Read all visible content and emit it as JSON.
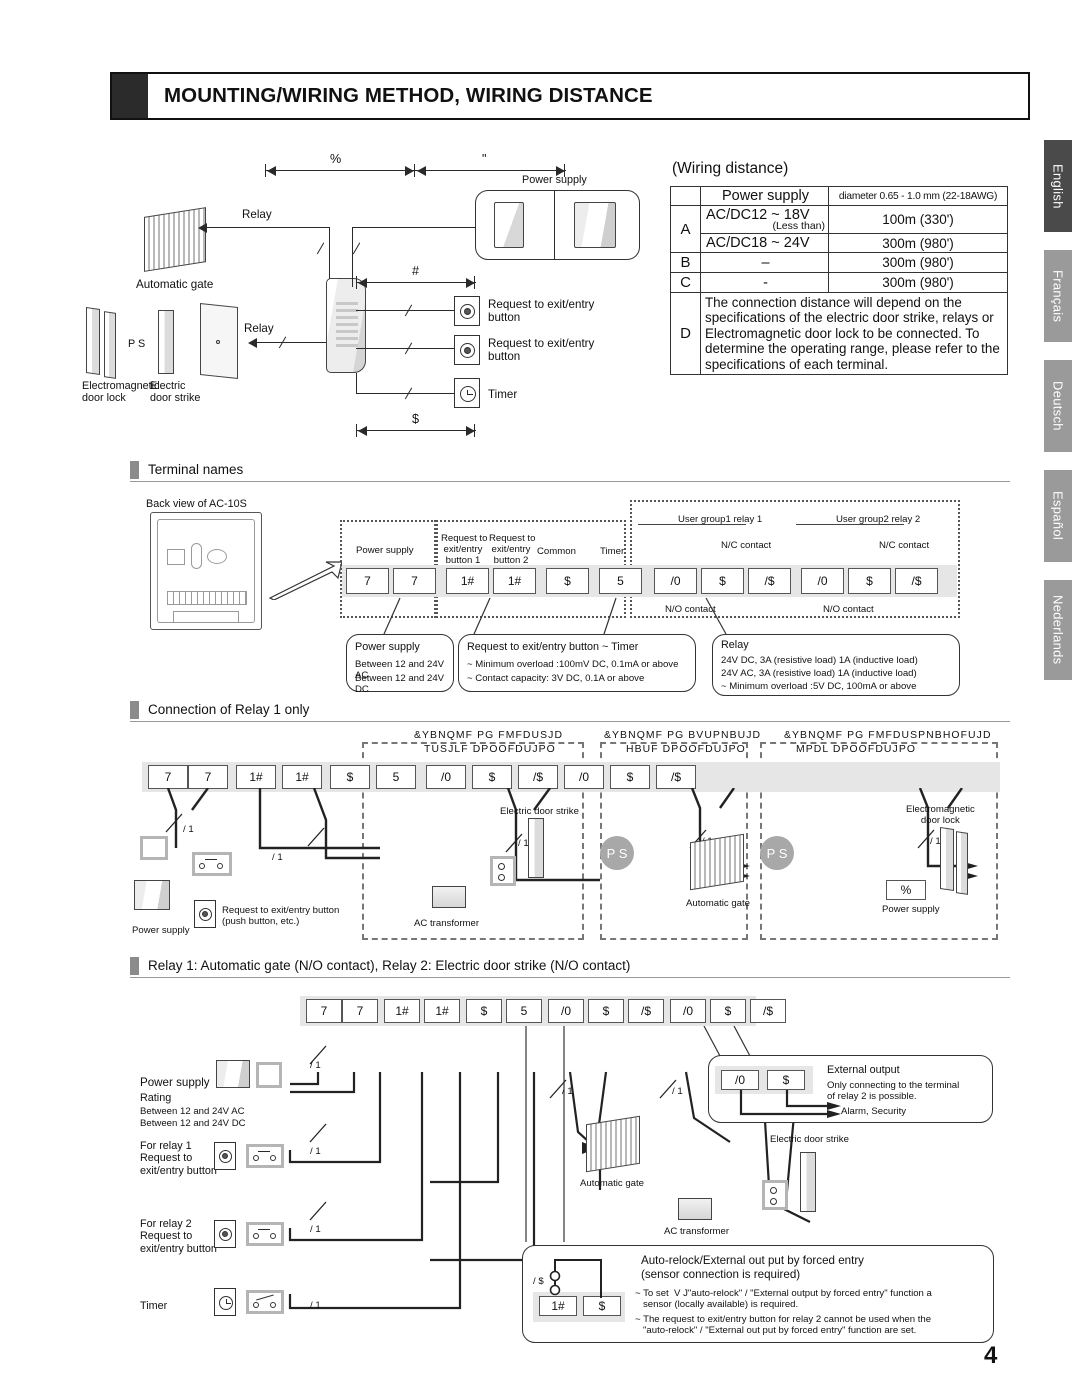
{
  "header": {
    "title": "MOUNTING/WIRING METHOD, WIRING DISTANCE"
  },
  "page_number": "4",
  "language_tabs": [
    {
      "label": "English",
      "active": true,
      "color": "#4a4a4a"
    },
    {
      "label": "Français",
      "active": false,
      "color": "#9a9a9a"
    },
    {
      "label": "Deutsch",
      "active": false,
      "color": "#9a9a9a"
    },
    {
      "label": "Español",
      "active": false,
      "color": "#9a9a9a"
    },
    {
      "label": "Nederlands",
      "active": false,
      "color": "#9a9a9a"
    }
  ],
  "top_diagram": {
    "dim_a": "%",
    "dim_b": "\"",
    "dim_c": "#",
    "dim_d": "$",
    "power_supply": "Power supply",
    "relay_gate": "Relay",
    "relay_door": "Relay",
    "automatic_gate": "Automatic gate",
    "electromagnetic_door_lock": "Electromagnetic\ndoor lock",
    "electric_door_strike": "Electric\ndoor strike",
    "ps_mark": "P S",
    "request_button_1": "Request to exit/entry\nbutton",
    "request_button_2": "Request to exit/entry\nbutton",
    "timer": "Timer"
  },
  "wiring_distance": {
    "title": "(Wiring distance)",
    "col_power_supply": "Power supply",
    "col_diameter": "diameter 0.65 - 1.0 mm (22-18AWG)",
    "rows": [
      {
        "key": "A",
        "power": "AC/DC12 ~ 18V",
        "note": "(Less than)",
        "distance": "100m (330')"
      },
      {
        "key": "",
        "power": "AC/DC18 ~ 24V",
        "note": "",
        "distance": "300m (980')"
      },
      {
        "key": "B",
        "power": "–",
        "note": "",
        "distance": "300m (980')"
      },
      {
        "key": "C",
        "power": "-",
        "note": "",
        "distance": "300m (980')"
      }
    ],
    "row_d_key": "D",
    "row_d_text": "The connection distance will depend on the specifications of the electric door strike, relays or Electromagnetic door lock to be connected. To determine the operating range, please refer to the specifications of each terminal."
  },
  "terminal_names": {
    "heading": "Terminal names",
    "back_view_label": "Back view of AC-10S",
    "group_labels": {
      "power_supply": "Power supply",
      "req_btn_1": "Request to\nexit/entry\nbutton 1",
      "req_btn_2": "Request to\nexit/entry\nbutton 2",
      "common": "Common",
      "timer": "Timer",
      "user_group1": "User group1 relay 1",
      "user_group2": "User group2 relay 2",
      "nc_contact": "N/C contact",
      "no_contact": "N/O contact"
    },
    "terminals": [
      "7",
      "7",
      "1#",
      "1#",
      "$",
      "5",
      "/0",
      "$",
      "/$",
      "/0",
      "$",
      "/$"
    ],
    "callouts": [
      {
        "title": "Power supply",
        "lines": [
          "Between 12 and 24V AC",
          "Between 12 and 24V DC"
        ]
      },
      {
        "title": "Request to exit/entry button ~ Timer",
        "lines": [
          "~ Minimum overload :100mV DC, 0.1mA or above",
          "~ Contact capacity: 3V DC, 0.1A or above"
        ]
      },
      {
        "title": "Relay",
        "lines": [
          "24V DC, 3A (resistive load) 1A (inductive load)",
          "24V AC, 3A (resistive load) 1A (inductive load)",
          "~ Minimum overload :5V DC, 100mA or above"
        ]
      }
    ]
  },
  "relay1_section": {
    "heading": "Connection of Relay 1 only",
    "terminals": [
      "7",
      "7",
      "1#",
      "1#",
      "$",
      "5",
      "/0",
      "$",
      "/$",
      "/0",
      "$",
      "/$"
    ],
    "scrambled_titles": [
      {
        "line1": "&YBNQMF PG FMFDUSJD",
        "line2": "TUSJLF DPOOFDUJPO"
      },
      {
        "line1": "&YBNQMF PG BVUPNBUJD",
        "line2": "HBUF DPOOFDUJPO"
      },
      {
        "line1": "&YBNQMF PG FMFDUSPNBHOFUJD",
        "line2": "MPDL DPOOFDUJPO"
      }
    ],
    "labels": {
      "power_supply": "Power supply",
      "request_button": "Request to exit/entry button\n(push button, etc.)",
      "ac_transformer": "AC transformer",
      "electric_door_strike": "Electric door strike",
      "automatic_gate": "Automatic gate",
      "electromagnetic_door_lock": "Electromagnetic\ndoor lock",
      "ps_mark": "P S",
      "power_supply_right": "Power supply",
      "psu_symbol": "%"
    }
  },
  "relay12_section": {
    "heading": "Relay 1: Automatic gate (N/O contact), Relay 2: Electric door strike (N/O contact)",
    "terminals": [
      "7",
      "7",
      "1#",
      "1#",
      "$",
      "5",
      "/0",
      "$",
      "/$",
      "/0",
      "$",
      "/$"
    ],
    "power_supply": {
      "title": "Power supply",
      "rating": "Rating",
      "line1": "Between 12 and 24V AC",
      "line2": "Between 12 and 24V DC"
    },
    "relay1_button": "For relay 1\nRequest to\nexit/entry button",
    "relay2_button": "For relay 2\nRequest to\nexit/entry button",
    "timer": "Timer",
    "automatic_gate": "Automatic gate",
    "ac_transformer": "AC transformer",
    "electric_door_strike": "Electric door strike",
    "external_output": {
      "terminals": [
        "/0",
        "$"
      ],
      "title": "External output",
      "text": "Only connecting to the terminal\nof relay 2 is possible.",
      "arrow_label": "Alarm, Security"
    },
    "auto_relock": {
      "title": "Auto-relock/External out put by forced entry",
      "subtitle": "(sensor connection is required)",
      "terminal_side": "/ $",
      "terminals": [
        "1#",
        "$"
      ],
      "bullet1": "~ To set  V J\"auto-relock\" / \"External output by forced entry\" function a\n   sensor (locally available) is required.",
      "bullet2": "~ The request to exit/entry button for relay 2 cannot be used when the\n   \"auto-relock\" / \"External out put by forced entry\" function are set."
    }
  }
}
